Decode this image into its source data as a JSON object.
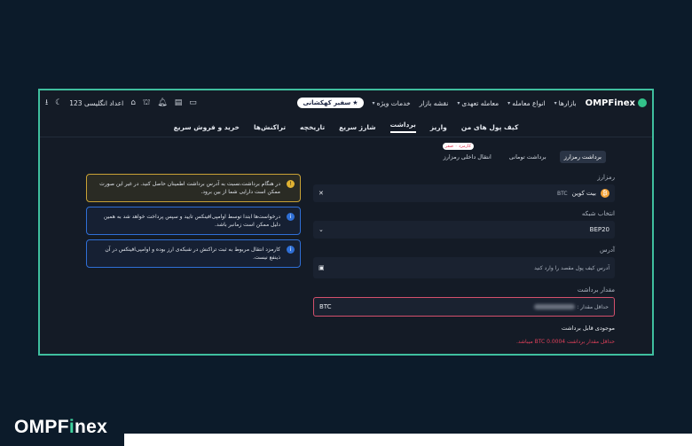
{
  "header": {
    "logo": "OMPFinex",
    "nav": [
      {
        "label": "بازارها"
      },
      {
        "label": "انواع معامله"
      },
      {
        "label": "معامله تعهدی"
      },
      {
        "label": "نقشه بازار"
      },
      {
        "label": "خدمات ویژه"
      }
    ],
    "ambassador": "سفیر کهکشانی",
    "ambassador_icon": "star-icon",
    "number_toggle": "اعداد انگلیسی 123"
  },
  "subnav": [
    {
      "label": "کیف پول های من"
    },
    {
      "label": "واریز"
    },
    {
      "label": "برداشت",
      "active": true
    },
    {
      "label": "شارژ سریع"
    },
    {
      "label": "تاریخچه"
    },
    {
      "label": "تراکنش‌ها"
    },
    {
      "label": "خرید و فروش سریع"
    }
  ],
  "tabs": {
    "crypto": "برداشت رمزارز",
    "toman": "برداشت تومانی",
    "internal": "انتقال داخلی رمزارز",
    "internal_badge": "کارمزد ۰ صفر"
  },
  "form": {
    "coin_label": "رمزارز",
    "coin_name": "بیت کوین",
    "coin_symbol": "BTC",
    "network_label": "انتخاب شبکه",
    "network_value": "BEP20",
    "address_label": "آدرس",
    "address_placeholder": "آدرس کیف پول مقصد را وارد کنید",
    "amount_label": "مقدار برداشت",
    "amount_min_label": "حداقل مقدار :",
    "amount_unit": "BTC",
    "balance_label": "موجودی قابل برداشت",
    "error": "حداقل مقدار برداشت BTC 0.0004 میباشد."
  },
  "notices": [
    {
      "type": "warn",
      "text": "در هنگام برداشت،نسبت به آدرس برداشت اطمینان حاصل کنید. در غیر این صورت ممکن است دارایی شما از بین برود."
    },
    {
      "type": "info",
      "text": "درخواست‌ها ابتدا توسط اوامپی‌افینکس تایید و سپس پرداخت خواهد شد به همین دلیل ممکن است زمانبر باشد."
    },
    {
      "type": "info",
      "text": "کارمزد انتقال مربوط به ثبت تراکنش در شبکه‌ی ارز بوده و اوامپی‌افینکس در آن ذینفع نیست."
    }
  ],
  "brand": {
    "prefix": "OMPF",
    "accent": "i",
    "suffix": "nex"
  },
  "colors": {
    "accent": "#3fbf9f",
    "error": "#e0405a",
    "btc": "#f2a33a",
    "info": "#2f6fd6",
    "warning": "#e0b232"
  }
}
